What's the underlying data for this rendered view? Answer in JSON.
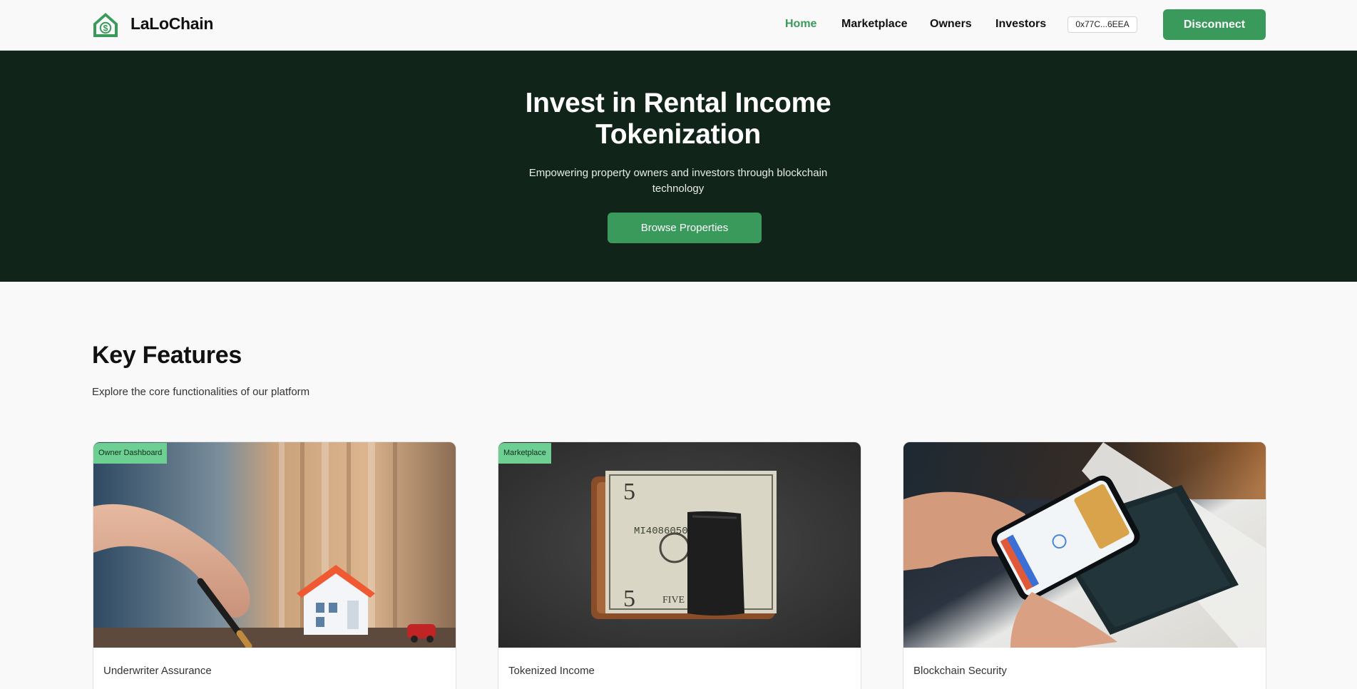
{
  "brand": {
    "name": "LaLoChain",
    "logo_icon": "house-dollar-icon",
    "accent": "#3a9a5c"
  },
  "nav": {
    "links": [
      {
        "label": "Home",
        "active": true
      },
      {
        "label": "Marketplace",
        "active": false
      },
      {
        "label": "Owners",
        "active": false
      },
      {
        "label": "Investors",
        "active": false
      }
    ],
    "wallet_address": "0x77C...6EEA",
    "disconnect_label": "Disconnect"
  },
  "hero": {
    "title": "Invest in Rental Income Tokenization",
    "subtitle": "Empowering property owners and investors through blockchain technology",
    "cta_label": "Browse Properties",
    "background": "#10241a"
  },
  "features": {
    "title": "Key Features",
    "subtitle": "Explore the core functionalities of our platform",
    "cards": [
      {
        "badge": "Owner Dashboard",
        "label": "Underwriter Assurance",
        "image": "hand-with-pen-and-model-house"
      },
      {
        "badge": "Marketplace",
        "label": "Tokenized Income",
        "image": "money-clip-with-five-dollar-bills"
      },
      {
        "badge": "",
        "label": "Blockchain Security",
        "image": "phone-payment-on-card-reader"
      }
    ]
  }
}
